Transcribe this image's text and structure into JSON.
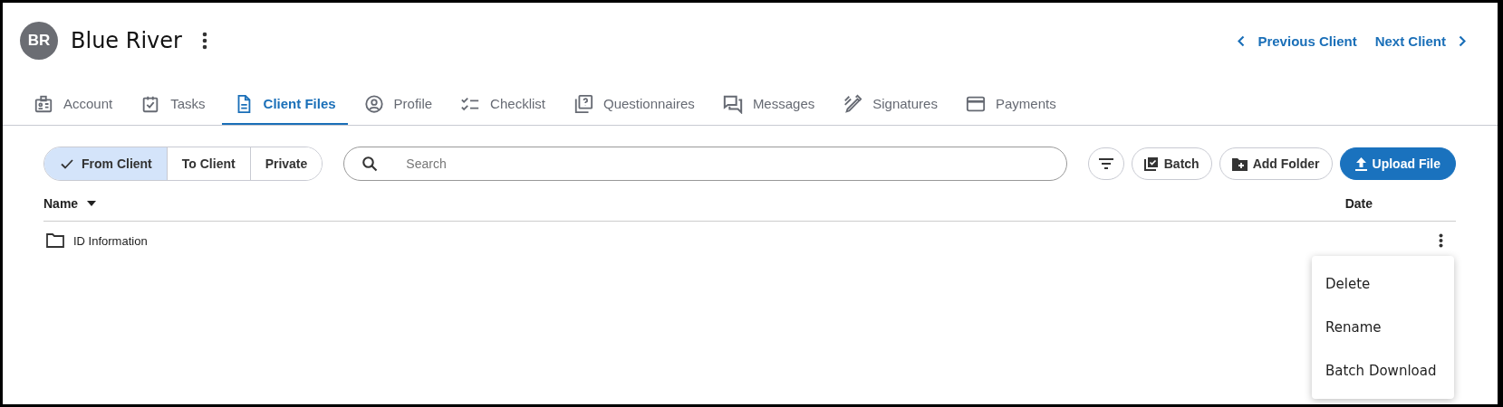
{
  "client": {
    "initials": "BR",
    "name": "Blue River"
  },
  "navigation": {
    "previous": "Previous Client",
    "next": "Next Client"
  },
  "tabs": [
    {
      "label": "Account",
      "selected": false
    },
    {
      "label": "Tasks",
      "selected": false
    },
    {
      "label": "Client Files",
      "selected": true
    },
    {
      "label": "Profile",
      "selected": false
    },
    {
      "label": "Checklist",
      "selected": false
    },
    {
      "label": "Questionnaires",
      "selected": false
    },
    {
      "label": "Messages",
      "selected": false
    },
    {
      "label": "Signatures",
      "selected": false
    },
    {
      "label": "Payments",
      "selected": false
    }
  ],
  "direction_filter": [
    {
      "label": "From Client",
      "selected": true
    },
    {
      "label": "To Client",
      "selected": false
    },
    {
      "label": "Private",
      "selected": false
    }
  ],
  "search": {
    "placeholder": "Search"
  },
  "actions": [
    {
      "label": "Batch",
      "kind": "batch"
    },
    {
      "label": "Add Folder",
      "kind": "folder"
    },
    {
      "label": "Upload File",
      "kind": "upload"
    }
  ],
  "table": {
    "columns": [
      {
        "label": "Name",
        "sorted": true
      },
      {
        "label": "Date",
        "sorted": false
      }
    ],
    "rows": [
      {
        "name": "ID Information",
        "kind": "folder"
      }
    ]
  },
  "row_menu": {
    "items": [
      "Delete",
      "Rename",
      "Batch Download"
    ]
  }
}
